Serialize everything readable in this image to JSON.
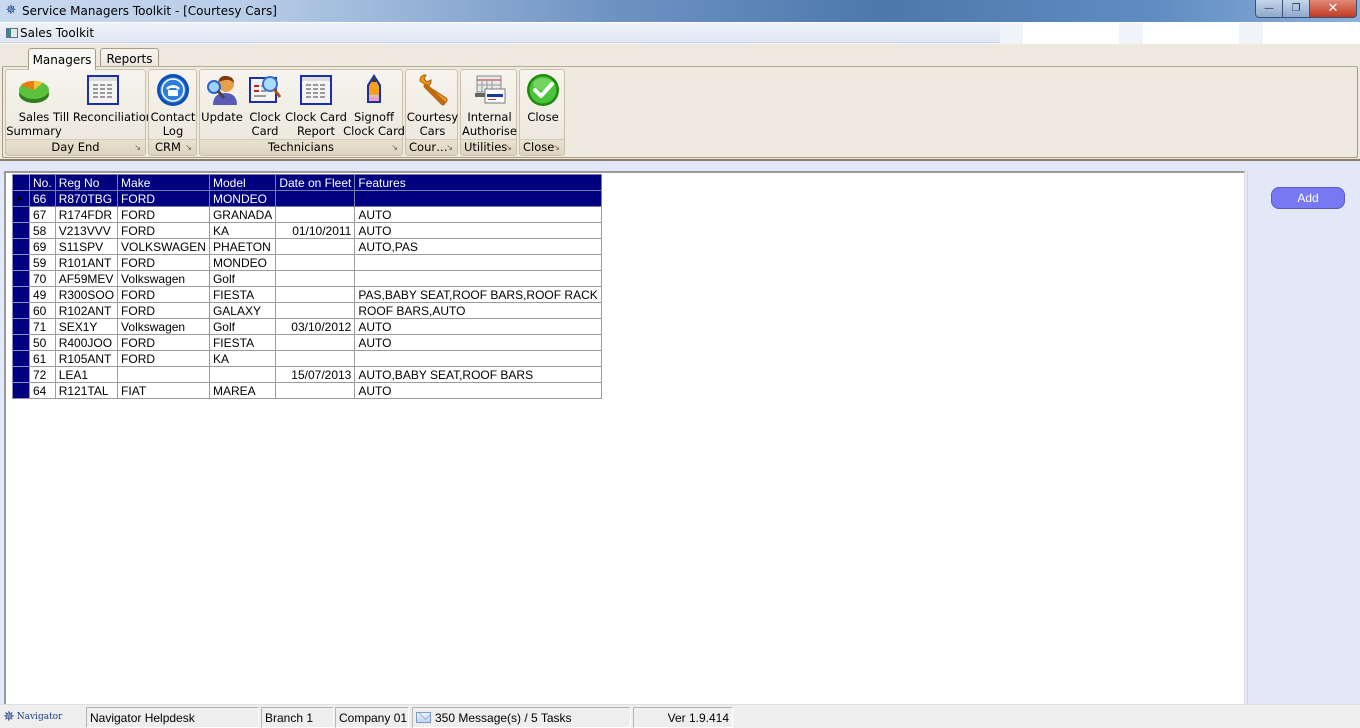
{
  "window": {
    "title": "Service Managers Toolkit - [Courtesy Cars]",
    "controls": {
      "minimize": "—",
      "restore": "❐",
      "close": "✕"
    }
  },
  "mdi": {
    "child_title": "Sales Toolkit"
  },
  "ribbon": {
    "tabs": [
      {
        "label": "Managers",
        "active": true
      },
      {
        "label": "Reports",
        "active": false
      }
    ],
    "groups": [
      {
        "caption": "Day End",
        "buttons": [
          {
            "label_line1": "Sales",
            "label_line2": "Summary",
            "icon": "pie-chart-icon"
          },
          {
            "label_line1": "Till Reconciliation",
            "label_line2": "",
            "icon": "table-sheet-icon"
          }
        ]
      },
      {
        "caption": "CRM",
        "buttons": [
          {
            "label_line1": "Contact",
            "label_line2": "Log",
            "icon": "telephone-icon"
          }
        ]
      },
      {
        "caption": "Technicians",
        "buttons": [
          {
            "label_line1": "Update",
            "label_line2": "",
            "icon": "user-search-icon"
          },
          {
            "label_line1": "Clock",
            "label_line2": "Card",
            "icon": "document-magnifier-icon"
          },
          {
            "label_line1": "Clock Card",
            "label_line2": "Report",
            "icon": "table-sheet-icon"
          },
          {
            "label_line1": "Signoff",
            "label_line2": "Clock Card",
            "icon": "pencil-icon"
          }
        ]
      },
      {
        "caption": "Cour…",
        "buttons": [
          {
            "label_line1": "Courtesy",
            "label_line2": "Cars",
            "icon": "wrench-icon"
          }
        ]
      },
      {
        "caption": "Utilities",
        "buttons": [
          {
            "label_line1": "Internal",
            "label_line2": "Authorise",
            "icon": "card-terminal-icon"
          }
        ]
      },
      {
        "caption": "Close",
        "buttons": [
          {
            "label_line1": "Close",
            "label_line2": "",
            "icon": "check-circle-icon"
          }
        ]
      }
    ],
    "launcher_glyph": "↘"
  },
  "grid": {
    "columns": [
      "No.",
      "Reg No",
      "Make",
      "Model",
      "Date on Fleet",
      "Features"
    ],
    "selected_row": 0,
    "rows": [
      [
        "66",
        "R870TBG",
        "FORD",
        "MONDEO",
        "",
        ""
      ],
      [
        "67",
        "R174FDR",
        "FORD",
        "GRANADA",
        "",
        "AUTO"
      ],
      [
        "58",
        "V213VVV",
        "FORD",
        "KA",
        "01/10/2011",
        "AUTO"
      ],
      [
        "69",
        "S11SPV",
        "VOLKSWAGEN",
        "PHAETON",
        "",
        "AUTO,PAS"
      ],
      [
        "59",
        "R101ANT",
        "FORD",
        "MONDEO",
        "",
        ""
      ],
      [
        "70",
        "AF59MEV",
        "Volkswagen",
        "Golf",
        "",
        ""
      ],
      [
        "49",
        "R300SOO",
        "FORD",
        "FIESTA",
        "",
        "PAS,BABY SEAT,ROOF BARS,ROOF RACK"
      ],
      [
        "60",
        "R102ANT",
        "FORD",
        "GALAXY",
        "",
        "ROOF BARS,AUTO"
      ],
      [
        "71",
        "SEX1Y",
        "Volkswagen",
        "Golf",
        "03/10/2012",
        "AUTO"
      ],
      [
        "50",
        "R400JOO",
        "FORD",
        "FIESTA",
        "",
        "AUTO"
      ],
      [
        "61",
        "R105ANT",
        "FORD",
        "KA",
        "",
        ""
      ],
      [
        "72",
        "LEA1",
        "",
        "",
        "15/07/2013",
        "AUTO,BABY SEAT,ROOF BARS"
      ],
      [
        "64",
        "R121TAL",
        "FIAT",
        "MAREA",
        "",
        "AUTO"
      ]
    ]
  },
  "side": {
    "add_label": "Add"
  },
  "statusbar": {
    "logo": "Navigator",
    "helpdesk": "Navigator Helpdesk",
    "branch": "Branch 1",
    "company": "Company 01",
    "messages": "350 Message(s) / 5 Tasks",
    "version": "Ver 1.9.414"
  },
  "colors": {
    "grid_header": "#000080",
    "add_button": "#7878f2",
    "content_bg": "#e3e8f9"
  }
}
